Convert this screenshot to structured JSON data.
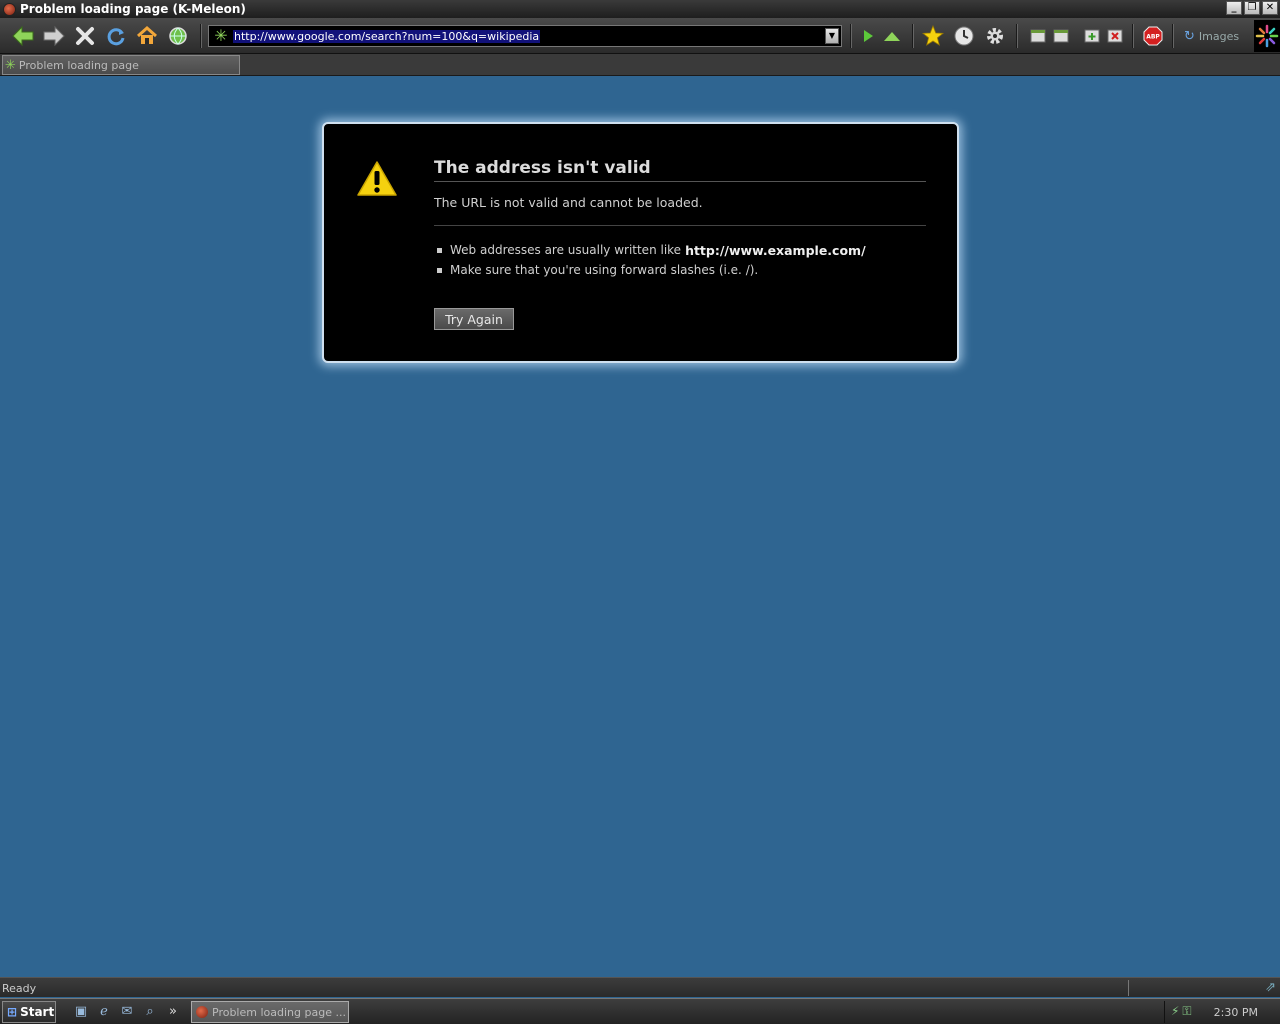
{
  "window": {
    "title": "Problem loading page (K-Meleon)",
    "buttons": {
      "minimize": "_",
      "restore": "❐",
      "close": "✕"
    }
  },
  "toolbar": {
    "url": "http://www.google.com/search?num=100&q=wikipedia",
    "images_label": "Images"
  },
  "tabs": [
    {
      "label": "Problem loading page"
    }
  ],
  "error": {
    "title": "The address isn't valid",
    "description": "The URL is not valid and cannot be loaded.",
    "bullet1_text": "Web addresses are usually written like",
    "bullet1_bold": "http://www.example.com/",
    "bullet2_text": "Make sure that you're using forward slashes (i.e. /).",
    "try_again": "Try Again"
  },
  "statusbar": {
    "text": "Ready"
  },
  "taskbar": {
    "start": "Start",
    "task_label": "Problem loading page ...",
    "more": "»",
    "clock": "2:30 PM"
  },
  "colors": {
    "background": "#2f6591",
    "error_box": "#000000",
    "warning": "#f5d10f"
  }
}
